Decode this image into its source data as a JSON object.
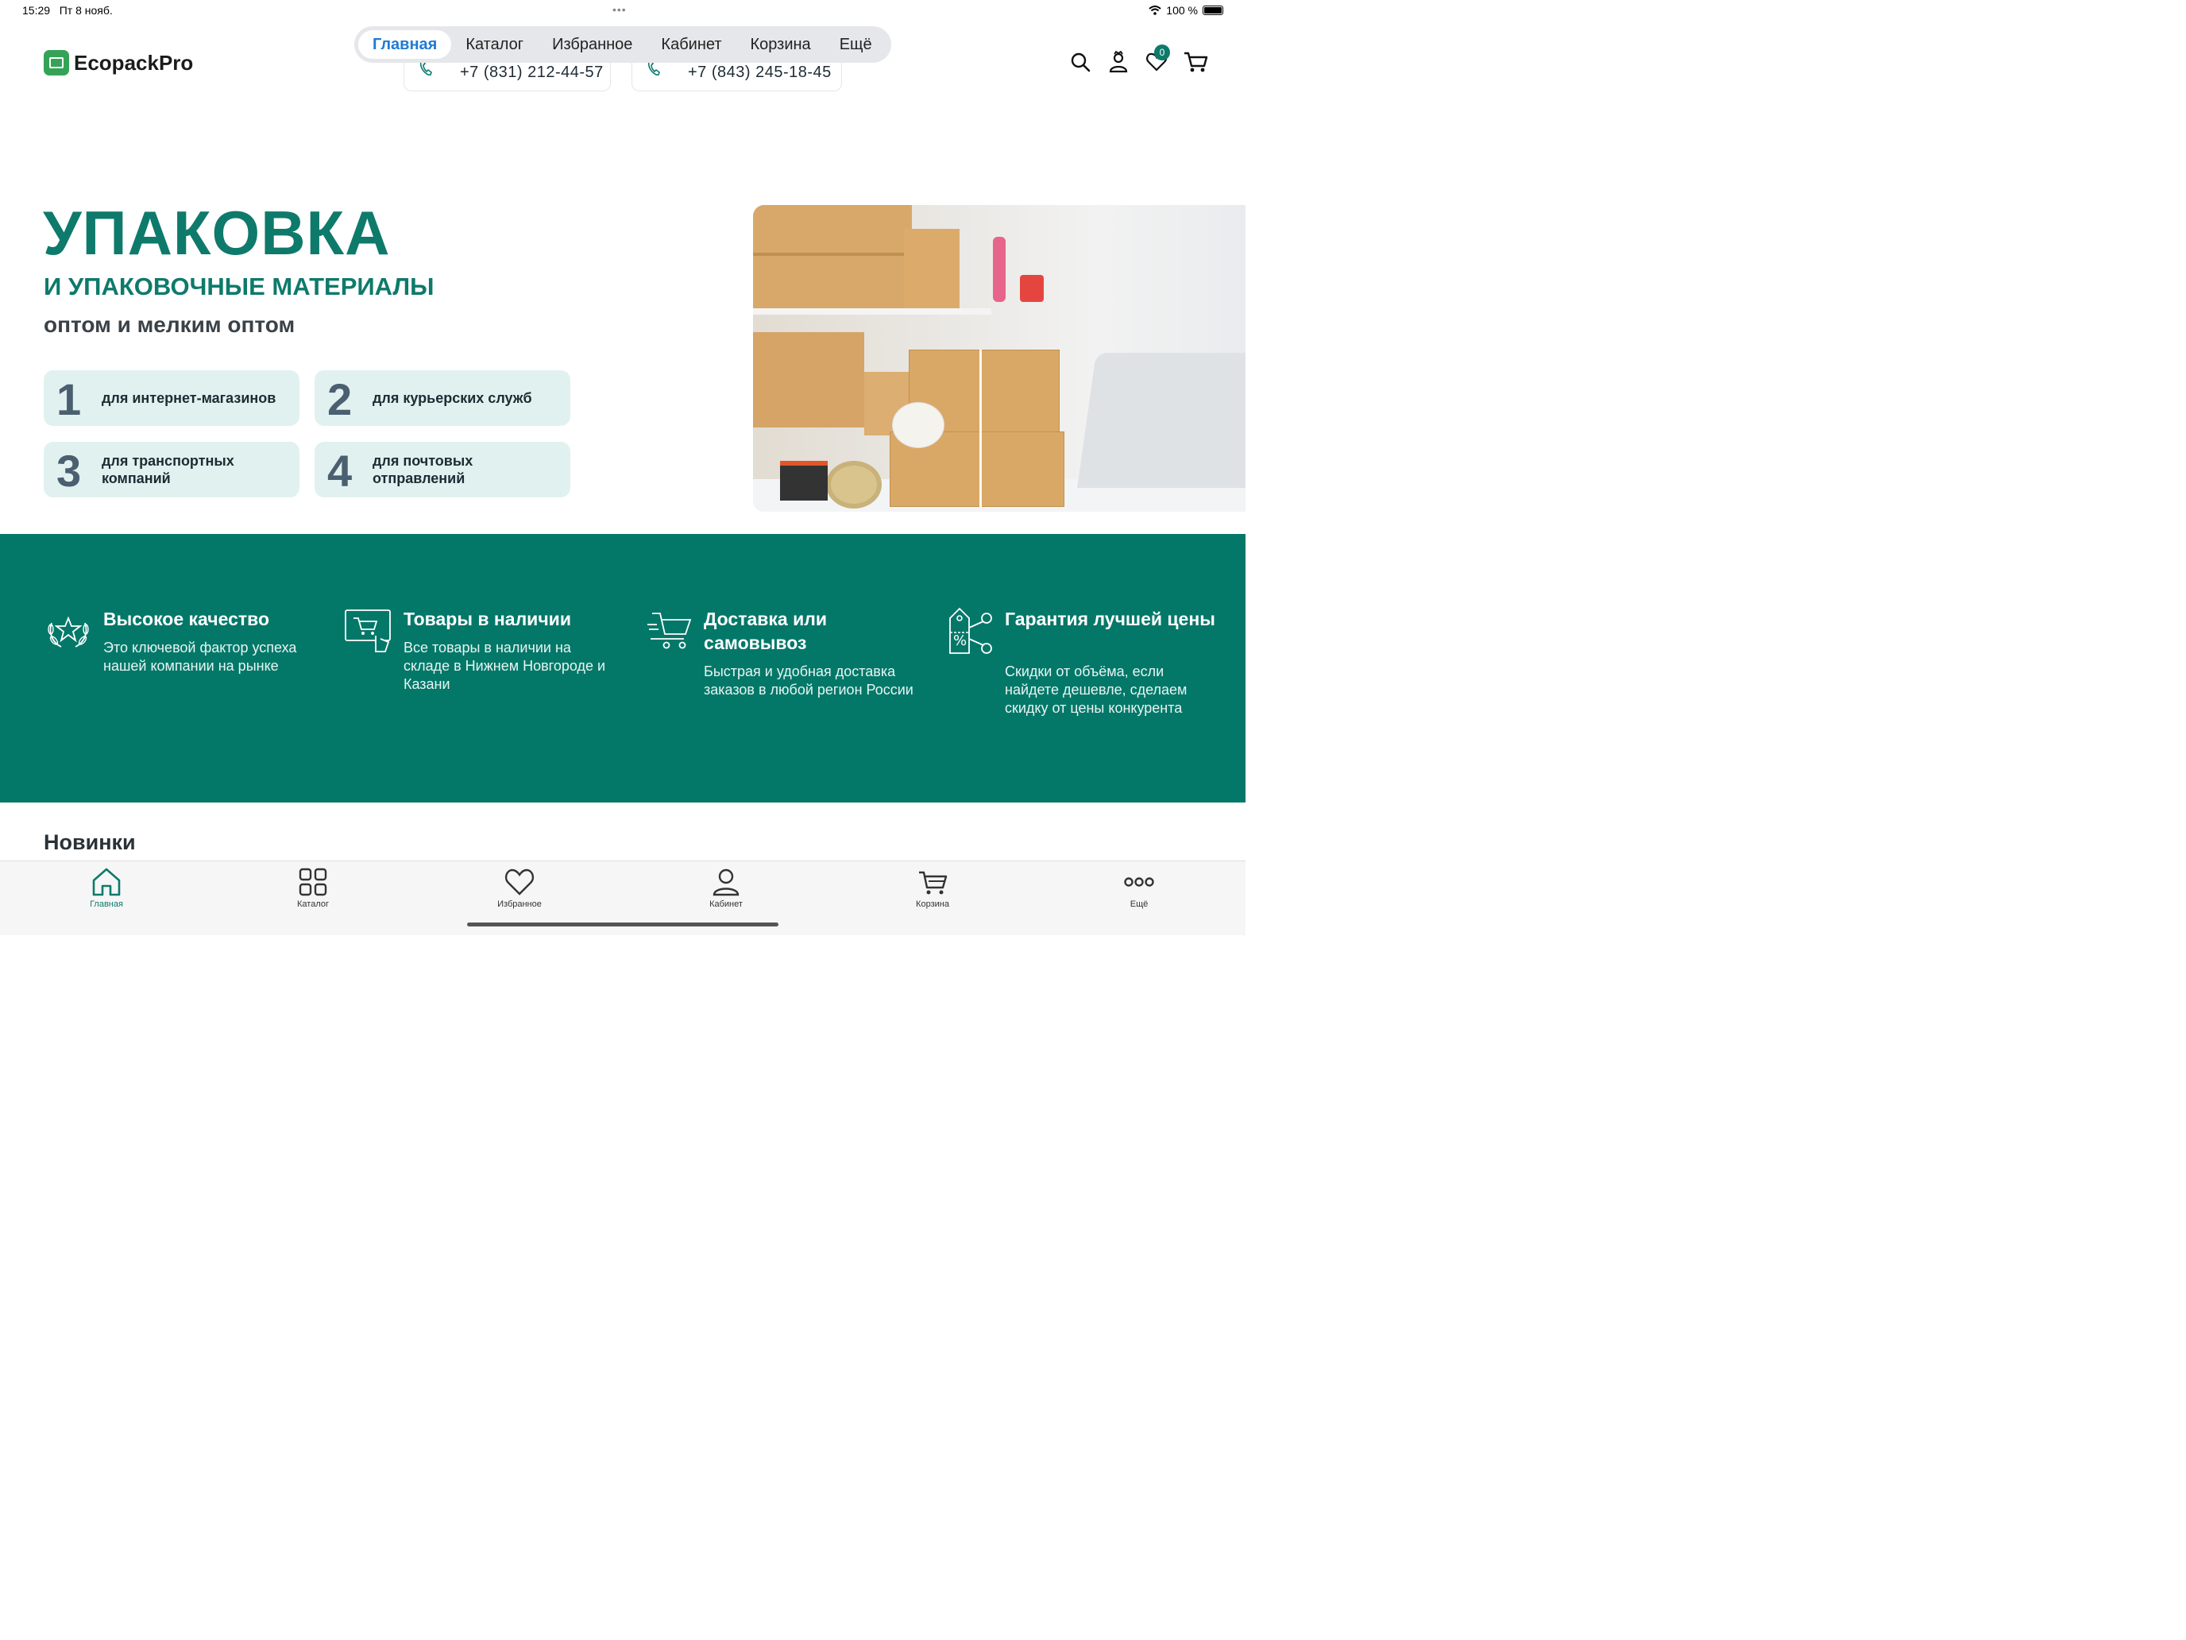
{
  "status_bar": {
    "time": "15:29",
    "date": "Пт 8 нояб.",
    "battery": "100 %"
  },
  "logo": {
    "text": "EcopackPro"
  },
  "tabs": [
    {
      "label": "Главная",
      "active": true
    },
    {
      "label": "Каталог"
    },
    {
      "label": "Избранное"
    },
    {
      "label": "Кабинет"
    },
    {
      "label": "Корзина"
    },
    {
      "label": "Ещё"
    }
  ],
  "phones": [
    "+7 (831) 212-44-57",
    "+7 (843) 245-18-45"
  ],
  "header": {
    "favorites_count": "0"
  },
  "hero": {
    "title": "УПАКОВКА",
    "subtitle": "И УПАКОВОЧНЫЕ МАТЕРИАЛЫ",
    "subtitle2": "оптом и мелким оптом",
    "features": [
      {
        "num": "1",
        "text": "для интернет-магазинов"
      },
      {
        "num": "2",
        "text": "для курьерских служб"
      },
      {
        "num": "3",
        "text": "для транспортных компаний"
      },
      {
        "num": "4",
        "text": "для почтовых отправлений"
      }
    ]
  },
  "benefits": [
    {
      "icon": "laurel-star-icon",
      "title": "Высокое качество",
      "text": "Это ключевой фактор успеха нашей компании на рынке"
    },
    {
      "icon": "online-cart-icon",
      "title": "Товары в наличии",
      "text": "Все товары в наличии на складе в Нижнем Новгороде и Казани"
    },
    {
      "icon": "fast-cart-icon",
      "title": "Доставка или самовывоз",
      "text": "Быстрая и удобная доставка заказов в любой регион России"
    },
    {
      "icon": "price-tag-icon",
      "title": "Гарантия лучшей цены",
      "text": "Скидки от объёма, если найдете дешевле, сделаем скидку от цены конкурента"
    }
  ],
  "section": {
    "title": "Новинки"
  },
  "bottom_nav": [
    {
      "label": "Главная",
      "icon": "home-icon",
      "active": true
    },
    {
      "label": "Каталог",
      "icon": "grid-icon"
    },
    {
      "label": "Избранное",
      "icon": "heart-icon"
    },
    {
      "label": "Кабинет",
      "icon": "user-icon"
    },
    {
      "label": "Корзина",
      "icon": "cart-icon"
    },
    {
      "label": "Ещё",
      "icon": "more-icon"
    }
  ],
  "colors": {
    "brand": "#037869",
    "accent_tab": "#1f7ad6",
    "feature_bg": "#e1f1f0"
  }
}
